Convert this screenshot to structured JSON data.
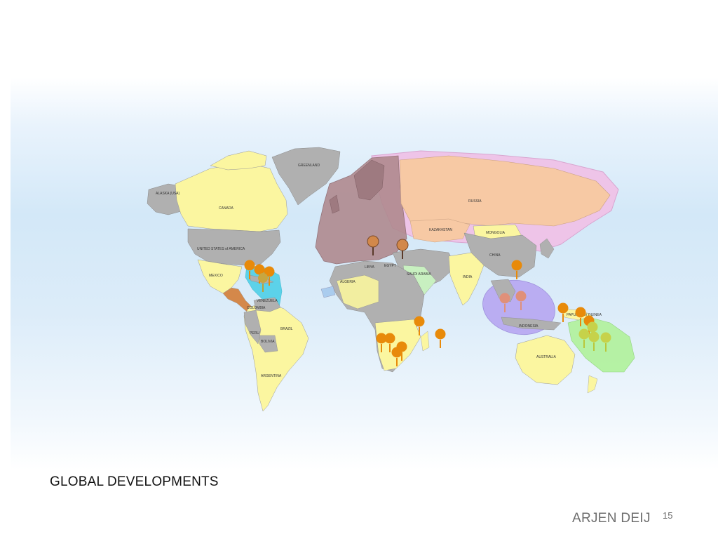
{
  "slide": {
    "title": "GLOBAL DEVELOPMENTS",
    "author": "ARJEN DEIJ",
    "page_number": "15"
  },
  "map": {
    "country_labels": {
      "greenland": "GREENLAND",
      "alaska": "ALASKA (USA)",
      "canada": "CANADA",
      "usa": "UNITED STATES of AMERICA",
      "mexico": "MEXICO",
      "venezuela": "VENEZUELA",
      "colombia": "COLOMBIA",
      "brazil": "BRAZIL",
      "bolivia": "BOLIVIA",
      "peru": "PERU",
      "argentina": "ARGENTINA",
      "russia": "RUSSIA",
      "kazakhstan": "KAZAKHSTAN",
      "mongolia": "MONGOLIA",
      "china": "CHINA",
      "india": "INDIA",
      "australia": "AUSTRALIA",
      "algeria": "ALGERIA",
      "libya": "LIBYA",
      "egypt": "EGYPT",
      "saudi_arabia": "SAUDI ARABIA",
      "indonesia": "INDONESIA",
      "papua_new_guinea": "PAPUA NEW GUINEA"
    },
    "colors": {
      "ocean_gradient": "#d3e8f8",
      "neutral_land": "#b0b0b0",
      "yellow_land": "#fbf6a0",
      "russia_peach": "#f7c9a4",
      "pink_region": "#eec4e8",
      "europe_mauve": "#b08a8f",
      "caribbean_cyan": "#4fd0e8",
      "se_asia_purple": "#b7a7f2",
      "pacific_green": "#b3f2a0",
      "pin_orange": "#e88a0a",
      "pin_salmon": "#e0907a",
      "pin_yellowgreen": "#b9c73a"
    }
  }
}
